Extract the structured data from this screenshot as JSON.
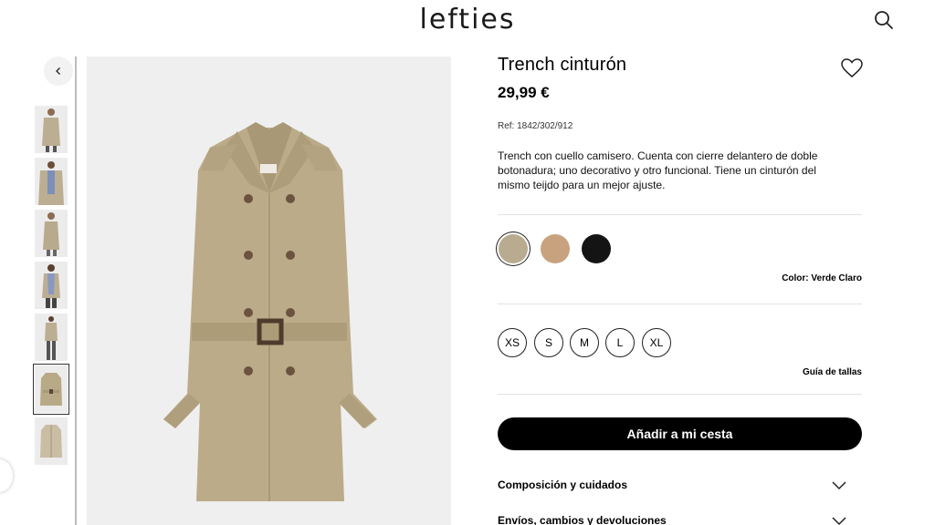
{
  "header": {
    "logo": "lefties",
    "search_icon": "search-icon"
  },
  "gallery": {
    "prev_icon": "chevron-left-icon",
    "thumbnails": [
      "front-model",
      "plaid-lining-model",
      "side-model",
      "back-model",
      "full-length-model",
      "flat-product",
      "flat-back"
    ],
    "active_index": 5
  },
  "product": {
    "title": "Trench cinturón",
    "price": "29,99 €",
    "ref": "Ref: 1842/302/912",
    "description": "Trench con cuello camisero. Cuenta con cierre delantero de doble botonadura; uno decorativo y otro funcional. Tiene un cinturón del mismo teijdo para un mejor ajuste.",
    "wishlist_icon": "heart-icon"
  },
  "colors": {
    "swatches": [
      {
        "name": "Verde Claro",
        "hex": "#b9ab8f",
        "selected": true
      },
      {
        "name": "Camel",
        "hex": "#c8a27e",
        "selected": false
      },
      {
        "name": "Negro",
        "hex": "#141414",
        "selected": false
      }
    ],
    "label": "Color: Verde Claro"
  },
  "sizes": {
    "options": [
      "XS",
      "S",
      "M",
      "L",
      "XL"
    ],
    "guide_label": "Guía de tallas"
  },
  "cart": {
    "add_label": "Añadir a mi cesta"
  },
  "accordion": [
    {
      "label": "Composición y cuidados"
    },
    {
      "label": "Envíos, cambios y devoluciones"
    }
  ]
}
